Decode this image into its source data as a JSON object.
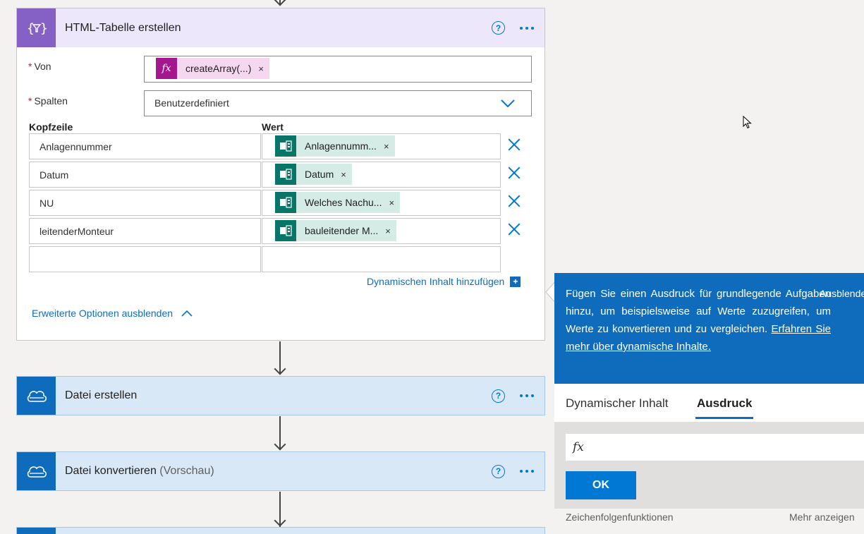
{
  "html_table_card": {
    "title": "HTML-Tabelle erstellen",
    "help": "?",
    "from": {
      "label": "Von",
      "token": {
        "icon": "fx",
        "label": "createArray(...)",
        "remove": "×"
      }
    },
    "columns": {
      "label": "Spalten",
      "value": "Benutzerdefiniert"
    },
    "table": {
      "header_col": "Kopfzeile",
      "value_col": "Wert",
      "rows": [
        {
          "key": "Anlagennummer",
          "value": "Anlagennumm...",
          "remove": "×"
        },
        {
          "key": "Datum",
          "value": "Datum",
          "remove": "×"
        },
        {
          "key": "NU",
          "value": "Welches Nachu...",
          "remove": "×"
        },
        {
          "key": "leitenderMonteur",
          "value": "bauleitender M...",
          "remove": "×"
        }
      ]
    },
    "add_dynamic": "Dynamischen Inhalt hinzufügen",
    "toggle_advanced": "Erweiterte Optionen ausblenden"
  },
  "steps": [
    {
      "title": "Datei erstellen",
      "help": "?"
    },
    {
      "title": "Datei konvertieren",
      "suffix": "(Vorschau)",
      "help": "?"
    }
  ],
  "dynamic_panel": {
    "info_text": "Fügen Sie einen Ausdruck für grundlegende Aufgaben hinzu, um beispielsweise auf Werte zuzugreifen, um Werte zu konvertieren und zu vergleichen.",
    "info_link": "Erfahren Sie mehr über dynamische Inhalte.",
    "hide_label": "Ausblenden",
    "tabs": [
      "Dynamischer Inhalt",
      "Ausdruck"
    ],
    "active_tab": "Ausdruck",
    "expression_placeholder": "fx",
    "ok_label": "OK",
    "footer_left": "Zeichenfolgenfunktionen",
    "footer_right": "Mehr anzeigen"
  },
  "colors": {
    "accent": "#0078d4",
    "purple_action": "#8661c5",
    "blue_action": "#0f6cbd",
    "forms_green": "#077568",
    "fx_magenta": "#a4178f"
  }
}
